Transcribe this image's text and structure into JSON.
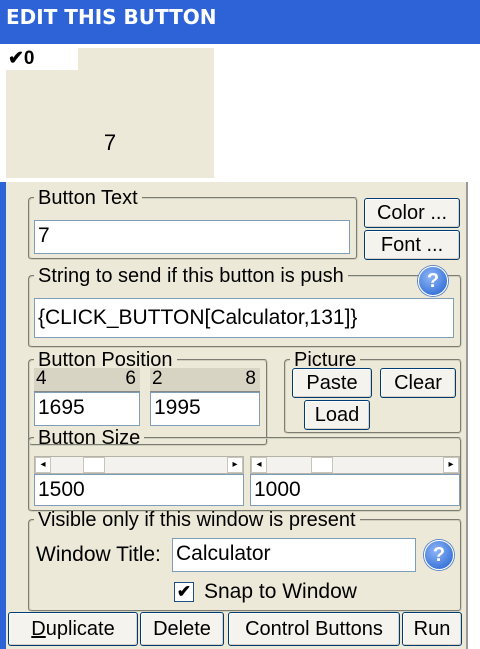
{
  "window": {
    "title": "EDIT THIS BUTTON"
  },
  "preview": {
    "check_mark": "✔",
    "check_value": "0",
    "label": "7"
  },
  "button_text": {
    "legend": "Button Text",
    "value": "7",
    "color_label": "Color ...",
    "font_label": "Font ..."
  },
  "send_string": {
    "legend": "String to send if this button is push",
    "value": "{CLICK_BUTTON[Calculator,131]}"
  },
  "position": {
    "legend": "Button Position",
    "x_arrows": [
      "4",
      "6"
    ],
    "y_arrows": [
      "2",
      "8"
    ],
    "x_value": "1695",
    "y_value": "1995"
  },
  "picture": {
    "legend": "Picture",
    "paste_label": "Paste",
    "clear_label": "Clear",
    "load_label": "Load"
  },
  "size": {
    "legend": "Button Size",
    "width_value": "1500",
    "height_value": "1000"
  },
  "visibility": {
    "legend": "Visible only if this window is present",
    "window_title_label": "Window Title:",
    "window_title_value": "Calculator",
    "snap_label": "Snap to Window",
    "snap_checked": true
  },
  "actions": {
    "duplicate_label": "uplicate",
    "duplicate_mnemonic": "D",
    "delete_label": "Delete",
    "control_buttons_label": "Control Buttons",
    "run_label": "Run"
  },
  "colors": {
    "titlebar": "#2d63d6",
    "panel": "#ece9d8",
    "help": "#1e5fd1"
  }
}
